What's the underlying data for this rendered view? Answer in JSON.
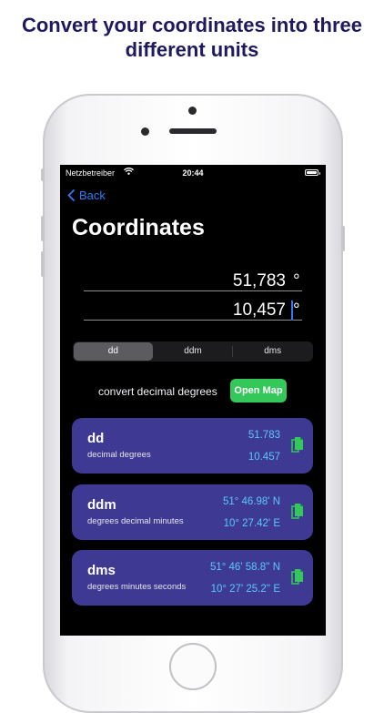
{
  "headline": {
    "line1": "Convert your coordinates into three",
    "line2": "different units"
  },
  "status_bar": {
    "carrier": "Netzbetreiber",
    "time": "20:44"
  },
  "nav": {
    "back_label": "Back",
    "title": "Coordinates"
  },
  "inputs": {
    "latitude": "51,783",
    "longitude": "10,457",
    "degree_symbol": "°"
  },
  "segments": [
    {
      "label": "dd",
      "selected": true
    },
    {
      "label": "ddm",
      "selected": false
    },
    {
      "label": "dms",
      "selected": false
    }
  ],
  "convert": {
    "label": "convert decimal degrees",
    "map_button": "Open Map"
  },
  "cards": [
    {
      "title": "dd",
      "subtitle": "decimal degrees",
      "line1": "51.783",
      "line2": "10.457",
      "icon": "copy-icon"
    },
    {
      "title": "ddm",
      "subtitle": "degrees decimal minutes",
      "line1": "51° 46.98' N",
      "line2": "10° 27.42' E",
      "icon": "copy-icon"
    },
    {
      "title": "dms",
      "subtitle": "degrees minutes seconds",
      "line1": "51° 46' 58.8'' N",
      "line2": "10° 27' 25.2'' E",
      "icon": "copy-icon"
    }
  ],
  "colors": {
    "headline": "#1f1a5e",
    "accent_blue": "#2f7bf6",
    "card_bg": "#3e3a93",
    "value_cyan": "#5ac8fa",
    "green": "#34c759"
  }
}
